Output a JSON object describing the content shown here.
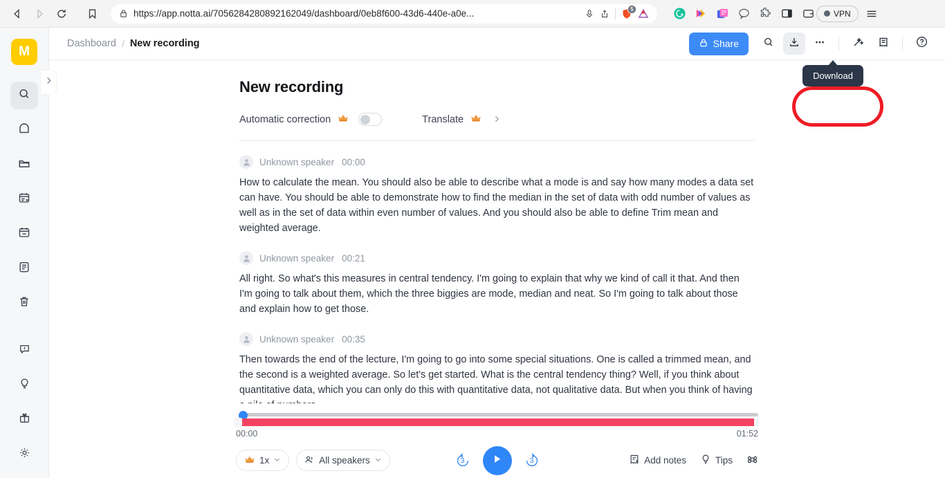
{
  "browser": {
    "url": "https://app.notta.ai/7056284280892162049/dashboard/0eb8f600-43d6-440e-a0e...",
    "back_label": "Back",
    "forward_label": "Forward",
    "reload_label": "Reload",
    "bookmark_label": "Bookmark this tab",
    "mic_icon": "microphone-icon",
    "share_icon": "share-icon",
    "shield_icon": "brave-shield-icon",
    "shield_count": "5",
    "brave_rewards_icon": "brave-rewards-icon",
    "extensions": [
      {
        "name": "grammarly-extension-icon",
        "label": "G"
      },
      {
        "name": "colorful-arrow-extension-icon",
        "label": ""
      },
      {
        "name": "pink-card-extension-icon",
        "label": ""
      },
      {
        "name": "chat-bubble-extension-icon",
        "label": ""
      },
      {
        "name": "puzzle-extensions-icon",
        "label": ""
      },
      {
        "name": "sidebar-panel-icon",
        "label": ""
      },
      {
        "name": "wallet-icon",
        "label": ""
      }
    ],
    "vpn_label": "VPN",
    "menu_label": "Customize and control"
  },
  "sidebar": {
    "avatar_initial": "M",
    "items": [
      {
        "name": "sidebar-item-search",
        "icon": "search-icon",
        "active": true
      },
      {
        "name": "sidebar-item-home",
        "icon": "home-icon",
        "active": false
      },
      {
        "name": "sidebar-item-folder",
        "icon": "folder-icon",
        "active": false
      },
      {
        "name": "sidebar-item-new-meeting",
        "icon": "calendar-add-icon",
        "active": false
      },
      {
        "name": "sidebar-item-calendar",
        "icon": "calendar-icon",
        "active": false
      },
      {
        "name": "sidebar-item-notes",
        "icon": "clipboard-icon",
        "active": false
      },
      {
        "name": "sidebar-item-trash",
        "icon": "trash-icon",
        "active": false
      }
    ],
    "bottom_items": [
      {
        "name": "sidebar-item-feedback",
        "icon": "feedback-bubble-icon"
      },
      {
        "name": "sidebar-item-tips",
        "icon": "lightbulb-icon"
      },
      {
        "name": "sidebar-item-gift",
        "icon": "gift-icon"
      },
      {
        "name": "sidebar-item-settings",
        "icon": "gear-icon"
      }
    ],
    "expand_icon": "chevron-right-icon"
  },
  "header": {
    "breadcrumb_root": "Dashboard",
    "breadcrumb_sep": "/",
    "breadcrumb_current": "New recording",
    "share_label": "Share",
    "share_icon": "lock-icon",
    "share_color": "#3d8bf7",
    "actions": [
      {
        "name": "search-button",
        "icon": "search-icon",
        "highlight": false
      },
      {
        "name": "download-button",
        "icon": "download-icon",
        "highlight": true
      },
      {
        "name": "more-options-button",
        "icon": "ellipsis-icon",
        "highlight": false
      },
      {
        "name": "ai-magic-button",
        "icon": "magic-wand-icon",
        "highlight": false
      },
      {
        "name": "notes-panel-button",
        "icon": "note-icon",
        "highlight": false
      },
      {
        "name": "help-button",
        "icon": "question-circle-icon",
        "highlight": false
      }
    ]
  },
  "tooltip": {
    "label": "Download",
    "bg_color": "#2b3648",
    "highlight_color": "#ee1c25"
  },
  "document": {
    "title": "New recording",
    "auto_correction_label": "Automatic correction",
    "auto_correction_badge": "premium-crown-icon",
    "auto_correction_on": false,
    "translate_label": "Translate",
    "translate_badge": "premium-crown-icon",
    "translate_chevron": "chevron-right-icon",
    "collapse_icon": "chevron-up-icon"
  },
  "transcript": [
    {
      "speaker": "Unknown speaker",
      "time": "00:00",
      "text": "How to calculate the mean. You should also be able to describe what a mode is and say how many modes a data set can have. You should be able to demonstrate how to find the median in the set of data with odd number of values as well as in the set of data within even number of values. And you should also be able to define Trim mean and weighted average."
    },
    {
      "speaker": "Unknown speaker",
      "time": "00:21",
      "text": "All right. So what's this measures in central tendency. I'm going to explain that why we kind of call it that. And then I'm going to talk about them, which the three biggies are mode, median and neat. So I'm going to talk about those and explain how to get those."
    },
    {
      "speaker": "Unknown speaker",
      "time": "00:35",
      "text": "Then towards the end of the lecture, I'm going to go into some special situations. One is called a trimmed mean, and the second is a weighted average. So let's get started. What is the central tendency thing? Well, if you think about quantitative data, which you can only do this with quantitative data, not qualitative data. But when you think of having a pile of numbers."
    }
  ],
  "player": {
    "current_time": "00:00",
    "total_time": "01:52",
    "progress_percent": 0,
    "track_color": "#c9cbcf",
    "waveform_color": "#f2425f",
    "handle_color": "#2f86f6",
    "speed_label": "1x",
    "speed_badge": "premium-crown-icon",
    "speakers_label": "All speakers",
    "speakers_icon": "people-icon",
    "rewind_label": "3",
    "forward_label": "3",
    "play_icon": "play-icon",
    "play_color": "#2f86f6",
    "add_notes_label": "Add notes",
    "add_notes_icon": "note-add-icon",
    "tips_label": "Tips",
    "tips_icon": "lightbulb-icon",
    "shortcuts_icon": "keyboard-shortcut-icon"
  }
}
